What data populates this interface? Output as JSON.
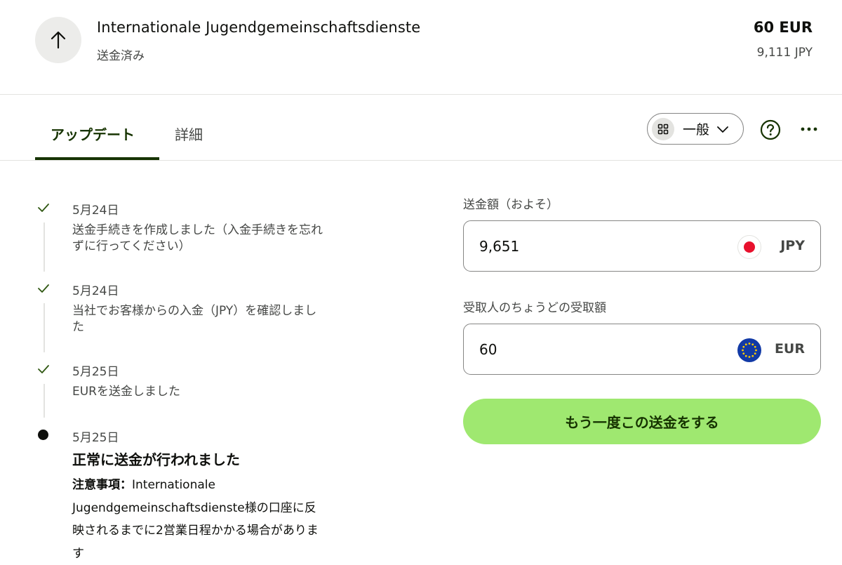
{
  "header": {
    "recipient_name": "Internationale Jugendgemeinschaftsdienste",
    "status": "送金済み",
    "amount_main": "60 EUR",
    "amount_sub": "9,111 JPY",
    "icon": "arrow-up-icon"
  },
  "tabs": {
    "updates_label": "アップデート",
    "details_label": "詳細"
  },
  "toolbar": {
    "view_select_label": "一般",
    "view_icon": "grid-icon",
    "help_icon": "help-circle-icon",
    "more_icon": "more-dots-icon"
  },
  "timeline": {
    "events": [
      {
        "date": "5月24日",
        "text": "送金手続きを作成しました（入金手続きを忘れずに行ってください）"
      },
      {
        "date": "5月24日",
        "text": "当社でお客様からの入金（JPY）を確認しました"
      },
      {
        "date": "5月25日",
        "text": "EURを送金しました"
      }
    ],
    "final": {
      "date": "5月25日",
      "heading": "正常に送金が行われました",
      "note_label": "注意事項：",
      "note_text": "Internationale Jugendgemeinschaftsdienste様の口座に反映されるまでに2営業日程かかる場合があります"
    }
  },
  "send_panel": {
    "send_label": "送金額（およそ）",
    "send_value": "9,651",
    "send_currency": "JPY",
    "receive_label": "受取人のちょうどの受取額",
    "receive_value": "60",
    "receive_currency": "EUR",
    "button_label": "もう一度この送金をする"
  },
  "colors": {
    "accent_green": "#9fe870",
    "forest_green": "#163300",
    "check_green": "#2f5711"
  }
}
